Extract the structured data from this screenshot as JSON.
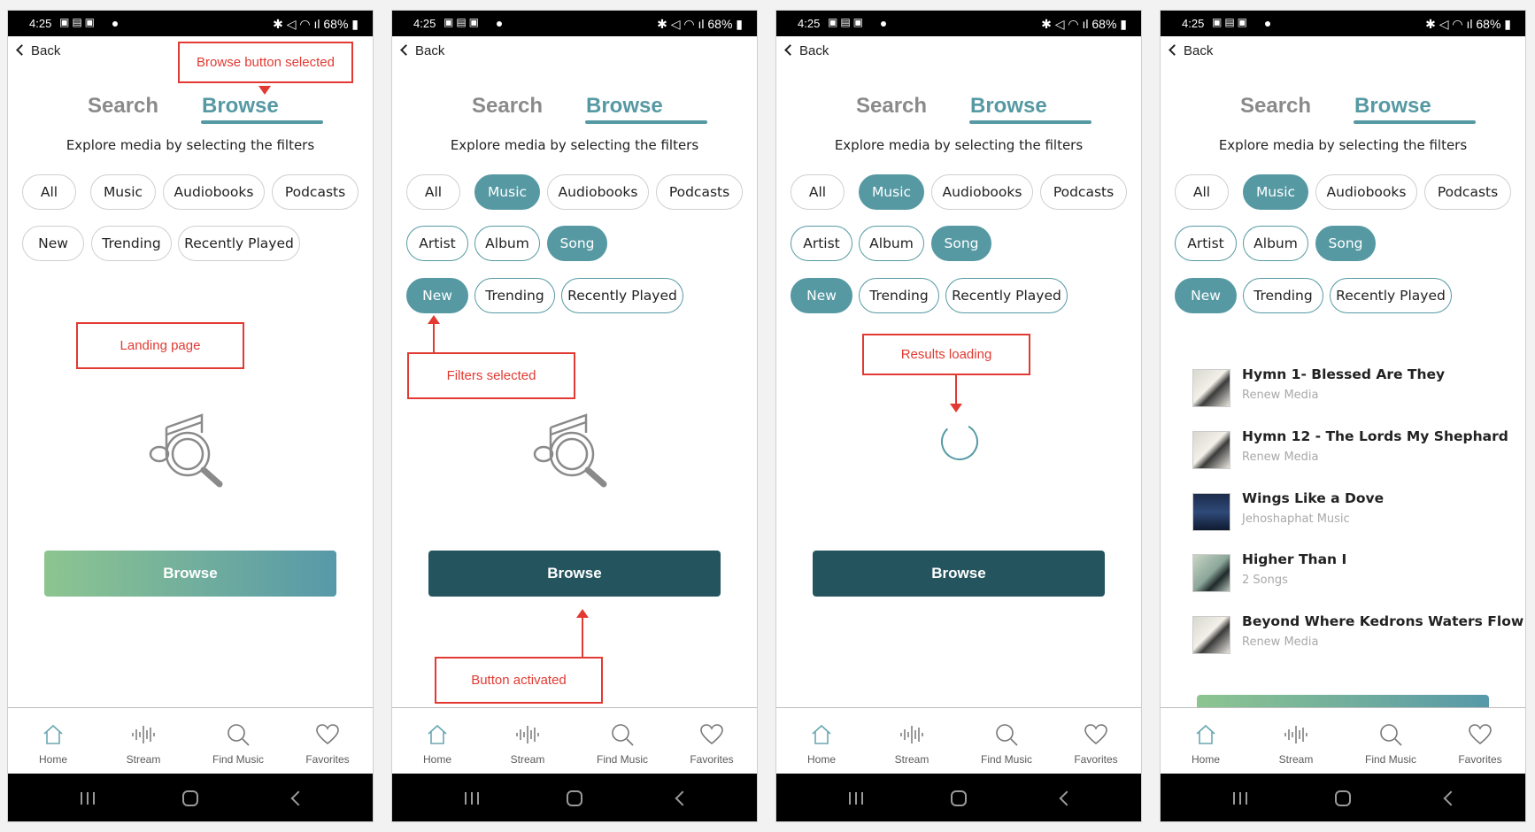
{
  "screens": [
    {
      "status": {
        "time": "4:25",
        "battery": "68%"
      },
      "back_label": "Back",
      "tabs": {
        "search": "Search",
        "browse": "Browse"
      },
      "subtitle": "Explore media by selecting the filters",
      "chips": {
        "all": "All",
        "music": "Music",
        "audiobooks": "Audiobooks",
        "podcasts": "Podcasts",
        "new": "New",
        "trending": "Trending",
        "recently_played": "Recently Played"
      },
      "annotations": {
        "top": "Browse button selected",
        "middle": "Landing page"
      },
      "browse_button": "Browse",
      "nav": {
        "home": "Home",
        "stream": "Stream",
        "find": "Find Music",
        "favorites": "Favorites"
      }
    },
    {
      "status": {
        "time": "4:25",
        "battery": "68%"
      },
      "back_label": "Back",
      "tabs": {
        "search": "Search",
        "browse": "Browse"
      },
      "subtitle": "Explore media by selecting the filters",
      "chips": {
        "all": "All",
        "music": "Music",
        "audiobooks": "Audiobooks",
        "podcasts": "Podcasts",
        "artist": "Artist",
        "album": "Album",
        "song": "Song",
        "new": "New",
        "trending": "Trending",
        "recently_played": "Recently Played"
      },
      "annotations": {
        "filters": "Filters selected",
        "button": "Button activated"
      },
      "browse_button": "Browse",
      "nav": {
        "home": "Home",
        "stream": "Stream",
        "find": "Find Music",
        "favorites": "Favorites"
      }
    },
    {
      "status": {
        "time": "4:25",
        "battery": "68%"
      },
      "back_label": "Back",
      "tabs": {
        "search": "Search",
        "browse": "Browse"
      },
      "subtitle": "Explore media by selecting the filters",
      "chips": {
        "all": "All",
        "music": "Music",
        "audiobooks": "Audiobooks",
        "podcasts": "Podcasts",
        "artist": "Artist",
        "album": "Album",
        "song": "Song",
        "new": "New",
        "trending": "Trending",
        "recently_played": "Recently Played"
      },
      "annotations": {
        "loading": "Results loading"
      },
      "browse_button": "Browse",
      "nav": {
        "home": "Home",
        "stream": "Stream",
        "find": "Find Music",
        "favorites": "Favorites"
      }
    },
    {
      "status": {
        "time": "4:25",
        "battery": "68%"
      },
      "back_label": "Back",
      "tabs": {
        "search": "Search",
        "browse": "Browse"
      },
      "subtitle": "Explore media by selecting the filters",
      "chips": {
        "all": "All",
        "music": "Music",
        "audiobooks": "Audiobooks",
        "podcasts": "Podcasts",
        "artist": "Artist",
        "album": "Album",
        "song": "Song",
        "new": "New",
        "trending": "Trending",
        "recently_played": "Recently Played"
      },
      "results": [
        {
          "title": "Hymn 1- Blessed Are They",
          "subtitle": "Renew Media"
        },
        {
          "title": "Hymn 12 - The Lords My Shephard",
          "subtitle": "Renew Media"
        },
        {
          "title": "Wings Like a Dove",
          "subtitle": "Jehoshaphat Music"
        },
        {
          "title": "Higher Than I",
          "subtitle": "2 Songs"
        },
        {
          "title": "Beyond Where Kedrons Waters Flow",
          "subtitle": "Renew Media"
        }
      ],
      "nav": {
        "home": "Home",
        "stream": "Stream",
        "find": "Find Music",
        "favorites": "Favorites"
      }
    }
  ],
  "colors": {
    "accent": "#5699a3",
    "dark_button": "#24555f",
    "annotation": "#e23a32",
    "gradient_start": "#8dc590",
    "gradient_end": "#5799a9"
  }
}
